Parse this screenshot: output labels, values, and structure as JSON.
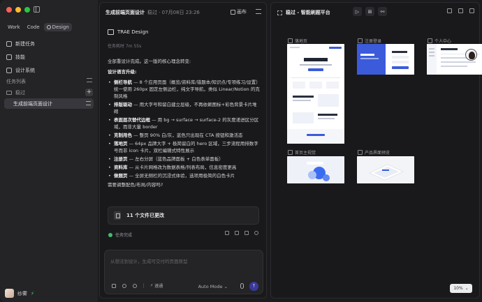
{
  "sidebar": {
    "modes": [
      {
        "label": "Work"
      },
      {
        "label": "Code"
      },
      {
        "label": "Design"
      }
    ],
    "nav": [
      {
        "label": "新建任务"
      },
      {
        "label": "技能"
      },
      {
        "label": "设计系统"
      }
    ],
    "task_list_title": "任务列表",
    "folder_name": "稳过",
    "active_task": "生成前端页面设计",
    "user_name": "纱雾"
  },
  "chat": {
    "title": "生成前端页面设计",
    "subtitle": "稳过 · 07月08日 23:26",
    "publish_label": "画布",
    "agent_name": "TRAE Design",
    "duration": "任务耗时 7m 55s",
    "intro": "全部重设计完成。这一版的核心理念转变:",
    "section_title": "设计语言升级:",
    "bullets": [
      {
        "head": "侧栏导航",
        "body": " — 8 个应用页面（概览/资料库/错题本/知识点/专项练习/设置）统一使用 260px 固定左侧边栏，纯文字导航，类似 Linear/Notion 的克制风格"
      },
      {
        "head": "排版驱动",
        "body": " — 用大字号和留白建立层级，不再依赖图标+彩色背景卡片堆砌"
      },
      {
        "head": "表面层次替代边框",
        "body": " — 用 bg → surface → surface-2 的灰度递进区分区域，而非大量 border"
      },
      {
        "head": "克制用色",
        "body": " — 整页 90% 白/灰，蓝色只出现在 CTA 按钮和激活态"
      },
      {
        "head": "落地页",
        "body": " — 64px 品牌大字 + 极简留白的 hero 区域，三步流程用排数字号而非 icon 卡片，双栏编辑式特性展示"
      },
      {
        "head": "注册页",
        "body": " — 左右分屏（蓝色品牌面板 + 白色表单面板）"
      },
      {
        "head": "资料库",
        "body": " — 从卡片网格改为数据表格/列表布局，信息密度更高"
      },
      {
        "head": "做题页",
        "body": " — 全屏无侧栏的沉浸式体验，选项用极简的白色卡片"
      }
    ],
    "outro": "需要调整配色/布局/内容吗?",
    "files_changed": "11 个文件已更改",
    "status": "任务完成",
    "input_placeholder": "从想法到设计，生成可交付的页面原型",
    "speed_label": "速通",
    "mode_label": "Auto Mode"
  },
  "canvas": {
    "title": "稳过 - 智能刷题平台",
    "boards": [
      {
        "label": "落地页"
      },
      {
        "label": "注册登录"
      },
      {
        "label": "个人中心"
      },
      {
        "label": "首页主视觉"
      },
      {
        "label": "产品界面预览"
      }
    ],
    "zoom": "10%"
  },
  "colors": {
    "accent": "#3b5bdb",
    "success": "#3fbf6a",
    "close": "#ff5f57",
    "minimize": "#febc2e",
    "maximize": "#28c840"
  }
}
